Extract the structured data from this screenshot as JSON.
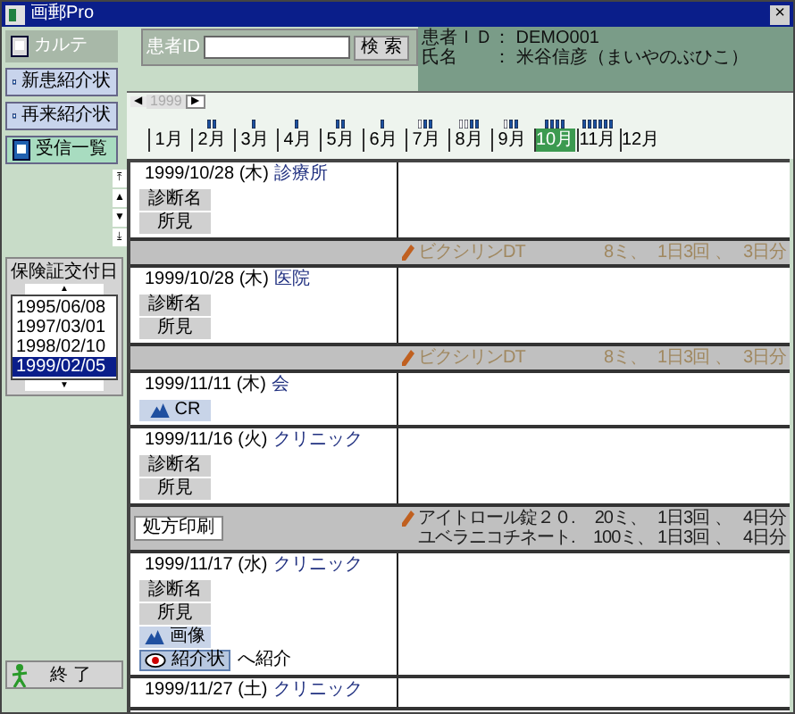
{
  "window": {
    "title": "画郵Pro",
    "close": "×"
  },
  "sidebar": {
    "items": [
      {
        "label": "カルテ",
        "kind": "tab",
        "selected": false
      },
      {
        "label": "新患紹介状",
        "kind": "button",
        "selected": false
      },
      {
        "label": "再来紹介状",
        "kind": "button",
        "selected": false
      },
      {
        "label": "受信一覧",
        "kind": "button",
        "selected": true
      }
    ],
    "insurance": {
      "title": "保険証交付日",
      "up": "▲",
      "down": "▼",
      "dates": [
        {
          "label": "1995/06/08",
          "selected": false
        },
        {
          "label": "1997/03/01",
          "selected": false
        },
        {
          "label": "1998/02/10",
          "selected": false
        },
        {
          "label": "1999/02/05",
          "selected": true
        }
      ]
    },
    "exit": "終 了"
  },
  "search": {
    "label": "患者ID",
    "button": "検 索"
  },
  "patient": {
    "id_line": "患者ＩＤ： DEMO001",
    "name_line": "氏名　　： 米谷信彦（まいやのぶひこ）"
  },
  "year_nav": {
    "prev": "◀",
    "year": "1999",
    "next": "▶"
  },
  "months": [
    {
      "label": "1月",
      "selected": false
    },
    {
      "label": "2月",
      "selected": false,
      "markers": [
        {
          "kind": "filled"
        },
        {
          "kind": "filled"
        }
      ]
    },
    {
      "label": "3月",
      "selected": false,
      "markers": [
        {
          "kind": "filled"
        }
      ]
    },
    {
      "label": "4月",
      "selected": false,
      "markers": [
        {
          "kind": "filled"
        }
      ]
    },
    {
      "label": "5月",
      "selected": false,
      "markers": [
        {
          "kind": "filled"
        },
        {
          "kind": "filled"
        }
      ]
    },
    {
      "label": "6月",
      "selected": false,
      "markers": [
        {
          "kind": "filled"
        }
      ]
    },
    {
      "label": "7月",
      "selected": false,
      "markers": [
        {
          "kind": "hollow"
        },
        {
          "kind": "filled"
        },
        {
          "kind": "filled"
        }
      ]
    },
    {
      "label": "8月",
      "selected": false,
      "markers": [
        {
          "kind": "hollow"
        },
        {
          "kind": "hollow"
        },
        {
          "kind": "filled"
        },
        {
          "kind": "filled"
        }
      ]
    },
    {
      "label": "9月",
      "selected": false,
      "markers": [
        {
          "kind": "hollow"
        },
        {
          "kind": "filled"
        },
        {
          "kind": "filled"
        }
      ]
    },
    {
      "label": "10月",
      "selected": true,
      "markers": [
        {
          "kind": "filled"
        },
        {
          "kind": "filled"
        },
        {
          "kind": "filled"
        },
        {
          "kind": "filled"
        }
      ]
    },
    {
      "label": "11月",
      "selected": false,
      "markers": [
        {
          "kind": "filled"
        },
        {
          "kind": "filled"
        },
        {
          "kind": "filled"
        },
        {
          "kind": "filled"
        },
        {
          "kind": "filled"
        },
        {
          "kind": "filled"
        }
      ]
    },
    {
      "label": "12月",
      "selected": false
    }
  ],
  "scroll_buttons": [
    "⤒",
    "▲",
    "▼",
    "⤓"
  ],
  "records": [
    {
      "date": "1999/10/28 (木)",
      "clinic": "診療所",
      "items": [
        {
          "label": "診断名",
          "kind": "plain"
        },
        {
          "label": "所見",
          "kind": "plain"
        }
      ],
      "prescriptions": [
        {
          "drug": "ビクシリンDT",
          "dose": "8ミ、",
          "frequency": "1日3回",
          "sep": "、",
          "days": "3日分",
          "dimmed": true
        }
      ]
    },
    {
      "date": "1999/10/28 (木)",
      "clinic": "医院",
      "items": [
        {
          "label": "診断名",
          "kind": "plain"
        },
        {
          "label": "所見",
          "kind": "plain"
        }
      ],
      "prescriptions": [
        {
          "drug": "ビクシリンDT",
          "dose": "8ミ、",
          "frequency": "1日3回",
          "sep": "、",
          "days": "3日分",
          "dimmed": true
        }
      ]
    },
    {
      "date": "1999/11/11 (木)",
      "clinic": "会",
      "items": [
        {
          "label": "CR",
          "kind": "image"
        }
      ]
    },
    {
      "date": "1999/11/16 (火)",
      "clinic": "クリニック",
      "items": [
        {
          "label": "診断名",
          "kind": "plain"
        },
        {
          "label": "所見",
          "kind": "plain"
        }
      ],
      "print_button": "処方印刷",
      "prescriptions": [
        {
          "drug": "アイトロール錠２０.",
          "dose": "20ミ、",
          "frequency": "1日3回",
          "sep": "、",
          "days": "4日分",
          "dimmed": false
        },
        {
          "drug": "ユベラニコチネート.",
          "dose": "100ミ、",
          "frequency": "1日3回",
          "sep": "、",
          "days": "4日分",
          "dimmed": false
        }
      ]
    },
    {
      "date": "1999/11/17 (水)",
      "clinic": "クリニック",
      "items": [
        {
          "label": "診断名",
          "kind": "plain"
        },
        {
          "label": "所見",
          "kind": "plain"
        },
        {
          "label": "画像",
          "kind": "image"
        },
        {
          "label": "紹介状",
          "kind": "referral",
          "note": "へ紹介"
        }
      ]
    },
    {
      "date": "1999/11/27 (土)",
      "clinic": "クリニック"
    }
  ]
}
